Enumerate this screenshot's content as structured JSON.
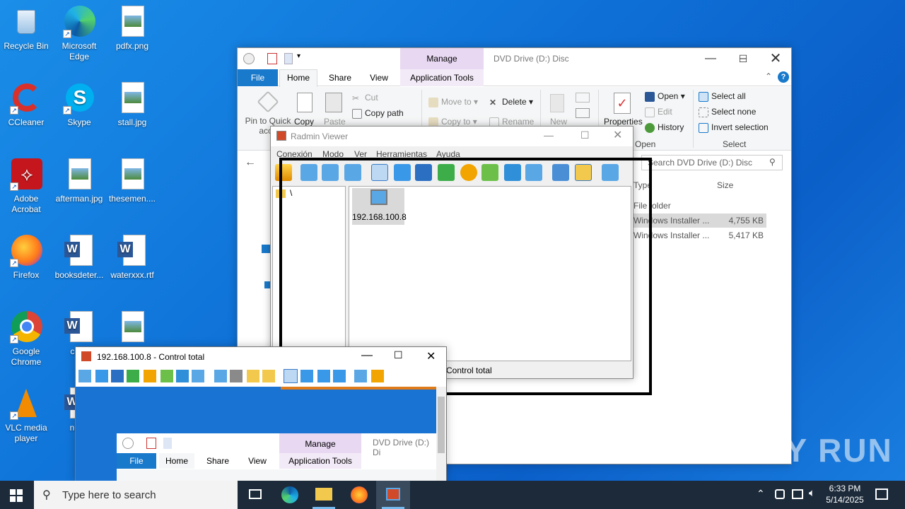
{
  "desktop": {
    "icons": [
      {
        "label": "Recycle Bin",
        "icon": "recycle-bin-icon"
      },
      {
        "label": "Microsoft Edge",
        "icon": "edge-icon"
      },
      {
        "label": "pdfx.png",
        "icon": "image-file-icon"
      },
      {
        "label": "CCleaner",
        "icon": "ccleaner-icon"
      },
      {
        "label": "Skype",
        "icon": "skype-icon"
      },
      {
        "label": "stall.jpg",
        "icon": "image-file-icon"
      },
      {
        "label": "Adobe Acrobat",
        "icon": "acrobat-icon"
      },
      {
        "label": "afterman.jpg",
        "icon": "image-file-icon"
      },
      {
        "label": "thesemen....",
        "icon": "image-file-icon"
      },
      {
        "label": "Firefox",
        "icon": "firefox-icon"
      },
      {
        "label": "booksdeter...",
        "icon": "word-doc-icon"
      },
      {
        "label": "waterxxx.rtf",
        "icon": "word-doc-icon"
      },
      {
        "label": "Google Chrome",
        "icon": "chrome-icon"
      },
      {
        "label": "catal",
        "icon": "word-doc-icon"
      },
      {
        "label": "",
        "icon": "image-file-icon"
      },
      {
        "label": "VLC media player",
        "icon": "vlc-icon"
      },
      {
        "label": "need",
        "icon": "word-doc-icon"
      }
    ]
  },
  "explorer": {
    "title": "DVD Drive (D:) Disc",
    "manage_tab": "Manage",
    "tabs": [
      "File",
      "Home",
      "Share",
      "View",
      "Application Tools"
    ],
    "clipboard": {
      "pin": "Pin to Quick acce",
      "copy": "Copy",
      "paste": "Paste",
      "cut": "Cut",
      "copy_path": "Copy path"
    },
    "organize": {
      "move_to": "Move to",
      "copy_to": "Copy to",
      "delete": "Delete",
      "rename": "Rename"
    },
    "new": {
      "new": "New"
    },
    "open_group": {
      "properties": "Properties",
      "open": "Open",
      "edit": "Edit",
      "history": "History",
      "label": "Open"
    },
    "select_group": {
      "select_all": "Select all",
      "select_none": "Select none",
      "invert": "Invert selection",
      "label": "Select"
    },
    "search_placeholder": "Search DVD Drive (D:) Disc",
    "columns": {
      "type": "Type",
      "size": "Size"
    },
    "rows": [
      {
        "type": "File folder",
        "size": ""
      },
      {
        "type": "Windows Installer ...",
        "size": "4,755 KB"
      },
      {
        "type": "Windows Installer ...",
        "size": "5,417 KB"
      }
    ]
  },
  "radmin": {
    "title": "Radmin Viewer",
    "menu": [
      "Conexión",
      "Modo",
      "Ver",
      "Herramientas",
      "Ayuda"
    ],
    "tree_root": "\\",
    "host": "192.168.100.8",
    "status": "Control total"
  },
  "remote": {
    "title": "192.168.100.8 - Control total",
    "explorer_title": "DVD Drive (D:) Di",
    "manage_tab": "Manage",
    "tabs": [
      "File",
      "Home",
      "Share",
      "View",
      "Application Tools"
    ]
  },
  "taskbar": {
    "search_placeholder": "Type here to search",
    "time": "6:33 PM",
    "date": "5/14/2025"
  },
  "watermark": "ANY RUN"
}
